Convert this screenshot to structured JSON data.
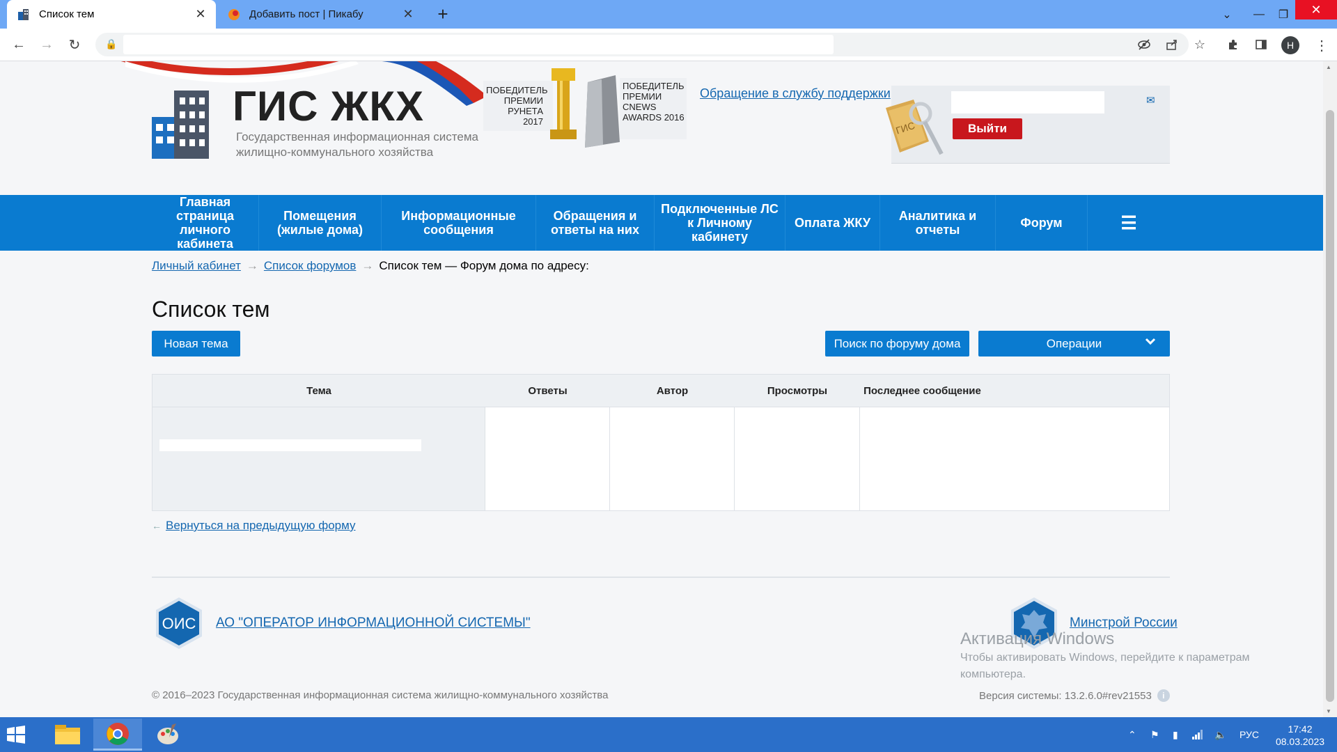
{
  "browser": {
    "tabs": [
      {
        "title": "Список тем"
      },
      {
        "title": "Добавить пост | Пикабу"
      }
    ],
    "new_tab": "+",
    "profile_initial": "H"
  },
  "header": {
    "logo_title": "ГИС ЖКХ",
    "logo_subtitle": "Государственная информационная система жилищно-коммунального хозяйства",
    "award_runet": "ПОБЕДИТЕЛЬ ПРЕМИИ РУНЕТА 2017",
    "award_cnews": "ПОБЕДИТЕЛЬ ПРЕМИИ CNEWS AWARDS 2016",
    "support_link": "Обращение в службу поддержки",
    "logout_label": "Выйти"
  },
  "nav": {
    "items": [
      {
        "label": "Главная страница личного кабинета"
      },
      {
        "label": "Помещения (жилые дома)"
      },
      {
        "label": "Информационные сообщения"
      },
      {
        "label": "Обращения и ответы на них"
      },
      {
        "label": "Подключенные ЛС к Личному кабинету"
      },
      {
        "label": "Оплата ЖКУ"
      },
      {
        "label": "Аналитика и отчеты"
      },
      {
        "label": "Форум"
      }
    ],
    "menu_icon": "hamburger-icon"
  },
  "breadcrumb": {
    "items": [
      {
        "label": "Личный кабинет"
      },
      {
        "label": "Список форумов"
      }
    ],
    "current": "Список тем — Форум дома по адресу:",
    "separator": "→"
  },
  "page": {
    "title": "Список тем",
    "new_topic_button": "Новая тема",
    "search_button": "Поиск по форуму дома",
    "operations_button": "Операции"
  },
  "table": {
    "columns": [
      "Тема",
      "Ответы",
      "Автор",
      "Просмотры",
      "Последнее сообщение"
    ]
  },
  "back_link": "Вернуться на предыдущую форму",
  "footer": {
    "ois_logo_text": "ОИС",
    "ois_name": "АО \"ОПЕРАТОР ИНФОРМАЦИОННОЙ СИСТЕМЫ\"",
    "minstroy_name": "Минстрой России",
    "copyright": "© 2016–2023 Государственная информационная система жилищно-коммунального хозяйства",
    "version": "Версия системы: 13.2.6.0#rev21553"
  },
  "activation": {
    "title": "Активация Windows",
    "text": "Чтобы активировать Windows, перейдите к параметрам компьютера."
  },
  "taskbar": {
    "language": "РУС",
    "time": "17:42",
    "date": "08.03.2023"
  },
  "colors": {
    "brand_blue": "#0a7bd0",
    "logout_red": "#c8171d",
    "link_blue": "#1467b0",
    "taskbar_blue": "#2b6fc9"
  }
}
